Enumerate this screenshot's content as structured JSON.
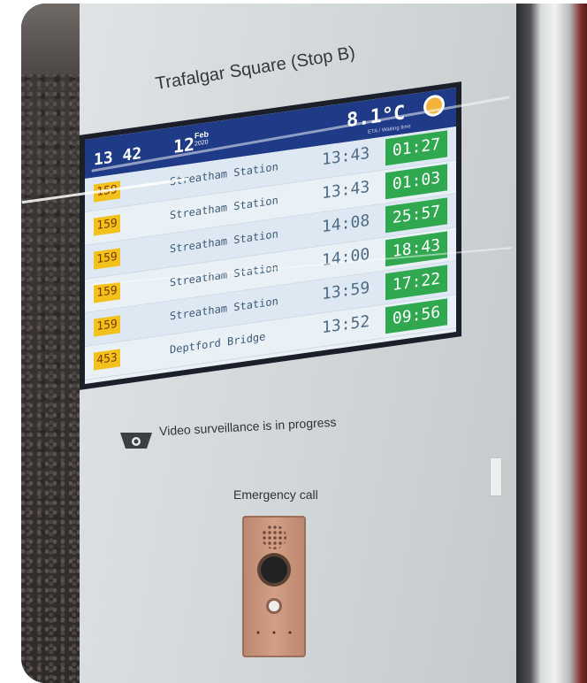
{
  "signage": {
    "stop_name": "Trafalgar Square (Stop B)",
    "surveillance_notice": "Video surveillance is in progress",
    "emergency_label": "Emergency call"
  },
  "display": {
    "time": "13 42",
    "day": "12",
    "month": "Feb",
    "year": "2020",
    "temperature": "8.1°C",
    "subheader": "ETA / Waiting time",
    "weather_icon": "sun-icon",
    "departures": [
      {
        "route": "159",
        "destination": "Streatham Station",
        "scheduled": "13:43",
        "eta": "01:27"
      },
      {
        "route": "159",
        "destination": "Streatham Station",
        "scheduled": "13:43",
        "eta": "01:03"
      },
      {
        "route": "159",
        "destination": "Streatham Station",
        "scheduled": "14:08",
        "eta": "25:57"
      },
      {
        "route": "159",
        "destination": "Streatham Station",
        "scheduled": "14:00",
        "eta": "18:43"
      },
      {
        "route": "159",
        "destination": "Streatham Station",
        "scheduled": "13:59",
        "eta": "17:22"
      },
      {
        "route": "453",
        "destination": "Deptford Bridge",
        "scheduled": "13:52",
        "eta": "09:56"
      }
    ],
    "colors": {
      "header": "#1f3a86",
      "route_badge": "#f2c11b",
      "eta": "#2fa84f"
    }
  }
}
